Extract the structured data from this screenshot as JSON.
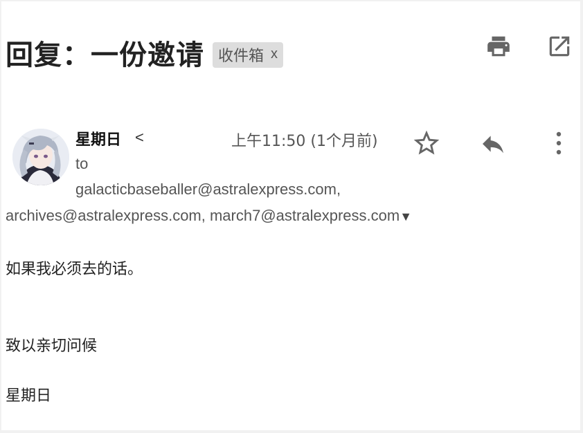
{
  "email": {
    "subject": "回复：一份邀请",
    "label_chip": "收件箱",
    "label_remove": "x",
    "sender_name": "星期日",
    "sender_bracket": "<",
    "timestamp": "上午11:50 (1个月前)",
    "to_label": "to",
    "recipients_line1": "galacticbaseballer@astralexpress.com,",
    "recipients_line2": "archives@astralexpress.com, march7@astralexpress.com",
    "expand_arrow": "▼",
    "body_line1": "如果我必须去的话。",
    "body_line2": "致以亲切问候",
    "body_line3": "星期日"
  },
  "icons": {
    "print": "print-icon",
    "open_new_window": "open-in-new-icon",
    "star": "star-outline-icon",
    "reply": "reply-icon",
    "more": "more-vertical-icon"
  },
  "colors": {
    "text_dark": "#222222",
    "text_muted": "#555555",
    "chip_bg": "#dddddd",
    "icon_gray": "#666666"
  }
}
